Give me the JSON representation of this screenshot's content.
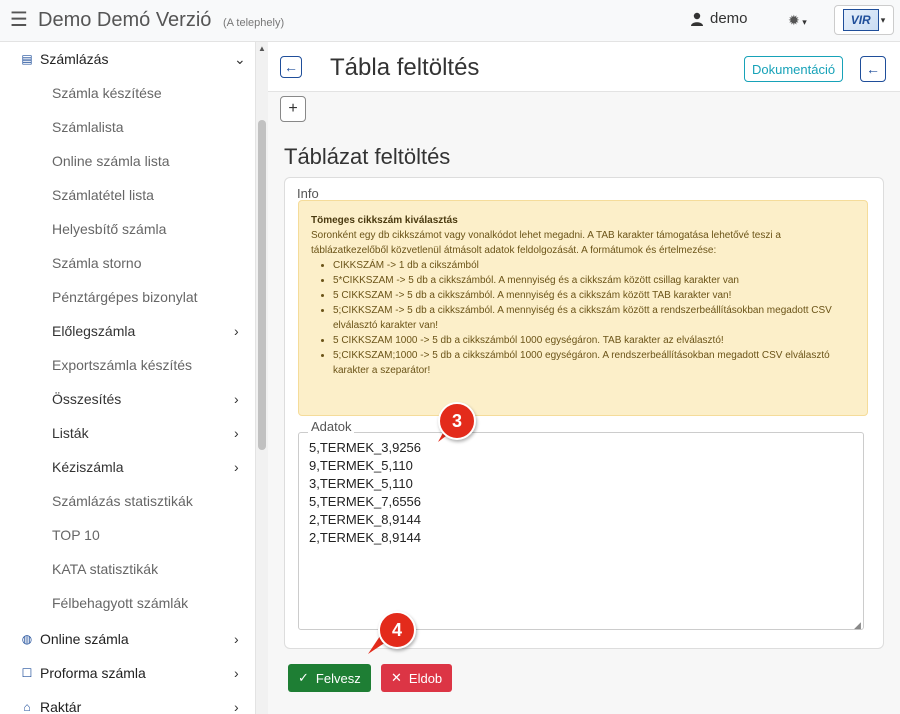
{
  "topbar": {
    "menu_icon": "hamburger-icon",
    "title": "Demo Demó Verzió",
    "subtitle": "(A telephely)",
    "user_name": "demo",
    "user_icon": "user-icon",
    "settings_icon": "gear-icon",
    "logo_text": "VIR"
  },
  "sidebar": {
    "items": [
      {
        "label": "Számlázás",
        "icon": "file-icon",
        "chevron": "⌄",
        "level": "top"
      },
      {
        "label": "Számla készítése",
        "level": "sub"
      },
      {
        "label": "Számlalista",
        "level": "sub"
      },
      {
        "label": "Online számla lista",
        "level": "sub"
      },
      {
        "label": "Számlatétel lista",
        "level": "sub"
      },
      {
        "label": "Helyesbítő számla",
        "level": "sub"
      },
      {
        "label": "Számla storno",
        "level": "sub"
      },
      {
        "label": "Pénztárgépes bizonylat",
        "level": "sub"
      },
      {
        "label": "Előlegszámla",
        "level": "sub",
        "chevron": "›"
      },
      {
        "label": "Exportszámla készítés",
        "level": "sub"
      },
      {
        "label": "Összesítés",
        "level": "sub",
        "chevron": "›"
      },
      {
        "label": "Listák",
        "level": "sub",
        "chevron": "›"
      },
      {
        "label": "Kéziszámla",
        "level": "sub",
        "chevron": "›"
      },
      {
        "label": "Számlázás statisztikák",
        "level": "sub"
      },
      {
        "label": "TOP 10",
        "level": "sub"
      },
      {
        "label": "KATA statisztikák",
        "level": "sub"
      },
      {
        "label": "Félbehagyott számlák",
        "level": "sub"
      },
      {
        "label": "Online számla",
        "icon": "globe-icon",
        "chevron": "›",
        "level": "top"
      },
      {
        "label": "Proforma számla",
        "icon": "document-icon",
        "chevron": "›",
        "level": "top"
      },
      {
        "label": "Raktár",
        "icon": "warehouse-icon",
        "chevron": "›",
        "level": "top"
      }
    ]
  },
  "page": {
    "title": "Tábla feltöltés",
    "doc_button": "Dokumentáció",
    "section_title": "Táblázat feltöltés",
    "info_legend": "Info",
    "info_title": "Tömeges cikkszám kiválasztás",
    "info_text": "Soronként egy db cikkszámot vagy vonalkódot lehet megadni. A TAB karakter támogatása lehetővé teszi a táblázatkezelőből közvetlenül átmásolt adatok feldolgozását. A formátumok és értelmezése:",
    "info_items": [
      "CIKKSZÁM -> 1 db a cikszámból",
      "5*CIKKSZAM -> 5 db a cikkszámból. A mennyiség és a cikkszám között csillag karakter van",
      "5 CIKKSZAM -> 5 db a cikkszámból. A mennyiség és a cikkszám között TAB karakter van!",
      "5;CIKKSZAM -> 5 db a cikkszámból. A mennyiség és a cikkszám között a rendszerbeállításokban megadott CSV elválasztó karakter van!",
      "5 CIKKSZAM 1000 -> 5 db a cikkszámból 1000 egységáron. TAB karakter az elválasztó!",
      "5;CIKKSZAM;1000 -> 5 db a cikkszámból 1000 egységáron. A rendszerbeállításokban megadott CSV elválasztó karakter a szeparátor!"
    ],
    "data_legend": "Adatok",
    "data_value": "5,TERMEK_3,9256\n9,TERMEK_5,110\n3,TERMEK_5,110\n5,TERMEK_7,6556\n2,TERMEK_8,9144\n2,TERMEK_8,9144",
    "save_label": "Felvesz",
    "delete_label": "Eldob"
  },
  "callouts": [
    "3",
    "4"
  ],
  "colors": {
    "brand": "#1f4e9a",
    "info_bg": "#fcefc9",
    "save": "#1e7e34",
    "delete": "#dc3545",
    "callout": "#e32b1b"
  }
}
